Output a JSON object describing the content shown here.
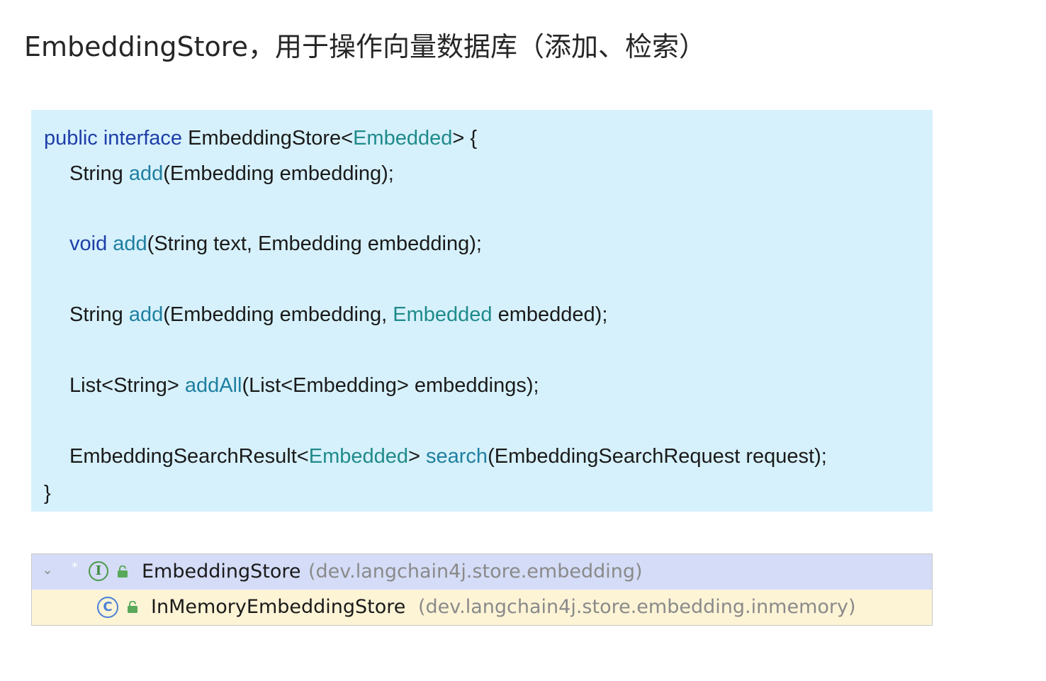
{
  "title": "EmbeddingStore，用于操作向量数据库（添加、检索）",
  "code": {
    "line1": {
      "kw": "public interface ",
      "name": "EmbeddingStore<",
      "generic": "Embedded",
      "rest": "> {"
    },
    "line2": {
      "ret": "String ",
      "fn": "add",
      "args": "(Embedding embedding);"
    },
    "line3": {
      "kw": "void ",
      "fn": "add",
      "args": "(String text, Embedding embedding);"
    },
    "line4": {
      "ret": "String ",
      "fn": "add",
      "args1": "(Embedding embedding, ",
      "generic": "Embedded",
      "args2": " embedded);"
    },
    "line5": {
      "ret": "List<String> ",
      "fn": "addAll",
      "args": "(List<Embedding> embeddings);"
    },
    "line6": {
      "ret1": "EmbeddingSearchResult<",
      "generic": "Embedded",
      "ret2": "> ",
      "fn": "search",
      "args": "(EmbeddingSearchRequest request);"
    },
    "line7": {
      "text": "}"
    }
  },
  "hierarchy": {
    "rows": [
      {
        "icon": "interface-icon",
        "icon_letter": "I",
        "name": "EmbeddingStore",
        "package": "(dev.langchain4j.store.embedding)"
      },
      {
        "icon": "class-icon",
        "icon_letter": "C",
        "name": "InMemoryEmbeddingStore",
        "package": "(dev.langchain4j.store.embedding.inmemory)"
      }
    ]
  },
  "colors": {
    "keyword": "#1f3ea8",
    "type": "#1f8a8a",
    "method": "#1f7fa0",
    "code_bg": "#d6f1fc",
    "selected_row": "#d4dcf7",
    "child_row": "#fdf4d6"
  }
}
